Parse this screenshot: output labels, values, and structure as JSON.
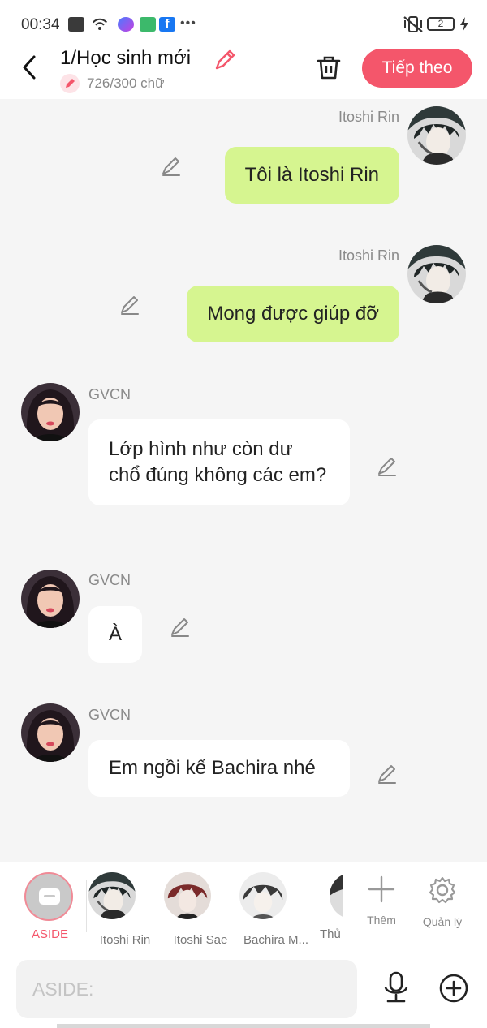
{
  "status_bar": {
    "time": "00:34",
    "battery": "2",
    "icons": [
      "close-box-icon",
      "wifi-icon",
      "messenger-icon",
      "store-icon",
      "facebook-icon",
      "more-dots-icon",
      "vibrate-off-icon",
      "charging-icon"
    ]
  },
  "header": {
    "title": "1/Học sinh mới",
    "word_count": "726/300 chữ",
    "next_label": "Tiếp theo"
  },
  "messages": [
    {
      "sender": "Itoshi Rin",
      "text": "Tôi là Itoshi Rin",
      "side": "right"
    },
    {
      "sender": "Itoshi Rin",
      "text": "Mong được giúp đỡ",
      "side": "right"
    },
    {
      "sender": "GVCN",
      "text": "Lớp hình như còn dư chổ đúng không các em?",
      "side": "left"
    },
    {
      "sender": "GVCN",
      "text": "À",
      "side": "left"
    },
    {
      "sender": "GVCN",
      "text": "Em ngồi kế Bachira nhé",
      "side": "left"
    }
  ],
  "characters": {
    "aside_label": "ASIDE",
    "list": [
      "Itoshi Rin",
      "Itoshi Sae",
      "Bachira M...",
      "Thủ"
    ],
    "more_label": "Thêm",
    "manage_label": "Quản lý"
  },
  "input": {
    "placeholder": "ASIDE:"
  },
  "colors": {
    "accent": "#f4566b",
    "outgoing_bubble": "#d6f590",
    "incoming_bubble": "#ffffff",
    "background": "#f5f5f5"
  }
}
